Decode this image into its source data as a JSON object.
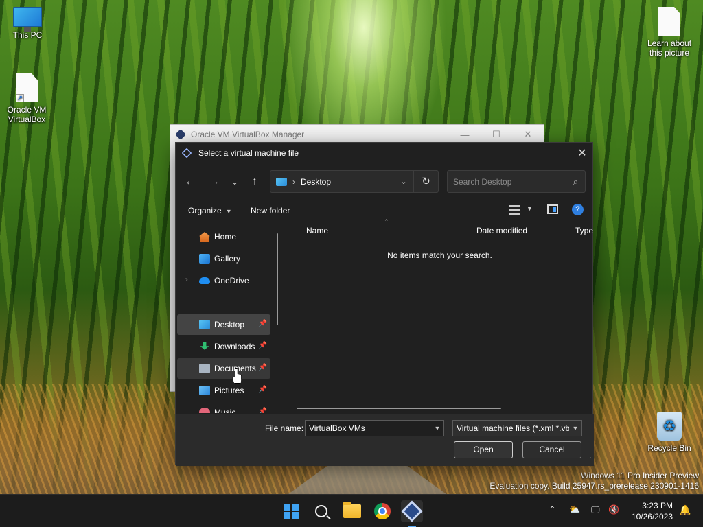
{
  "desktop": {
    "icons": [
      {
        "label": "This PC"
      },
      {
        "label": "Oracle VM VirtualBox"
      },
      {
        "label": "Learn about this picture"
      },
      {
        "label": "Recycle Bin"
      }
    ],
    "watermark": {
      "line1": "Windows 11 Pro Insider Preview",
      "line2": "Evaluation copy. Build 25947.rs_prerelease.230901-1416"
    }
  },
  "background_window": {
    "title": "Oracle VM VirtualBox Manager"
  },
  "dialog": {
    "title": "Select a virtual machine file",
    "address": {
      "location": "Desktop"
    },
    "search": {
      "placeholder": "Search Desktop"
    },
    "commands": {
      "organize": "Organize",
      "new_folder": "New folder"
    },
    "sidebar": {
      "items": [
        {
          "label": "Home"
        },
        {
          "label": "Gallery"
        },
        {
          "label": "OneDrive"
        },
        {
          "label": "Desktop",
          "pinned": true,
          "selected": true
        },
        {
          "label": "Downloads",
          "pinned": true
        },
        {
          "label": "Documents",
          "pinned": true,
          "hovered": true
        },
        {
          "label": "Pictures",
          "pinned": true
        },
        {
          "label": "Music",
          "pinned": true
        }
      ]
    },
    "columns": [
      "Name",
      "Date modified",
      "Type"
    ],
    "empty_message": "No items match your search.",
    "file_name_label": "File name:",
    "file_name_value": "VirtualBox VMs",
    "file_type_value": "Virtual machine files (*.xml *.vbox)",
    "buttons": {
      "open": "Open",
      "cancel": "Cancel"
    }
  },
  "taskbar": {
    "clock": {
      "time": "3:23 PM",
      "date": "10/26/2023"
    }
  },
  "colors": {
    "accent": "#3fa3f3",
    "dialog_bg": "#202020"
  }
}
